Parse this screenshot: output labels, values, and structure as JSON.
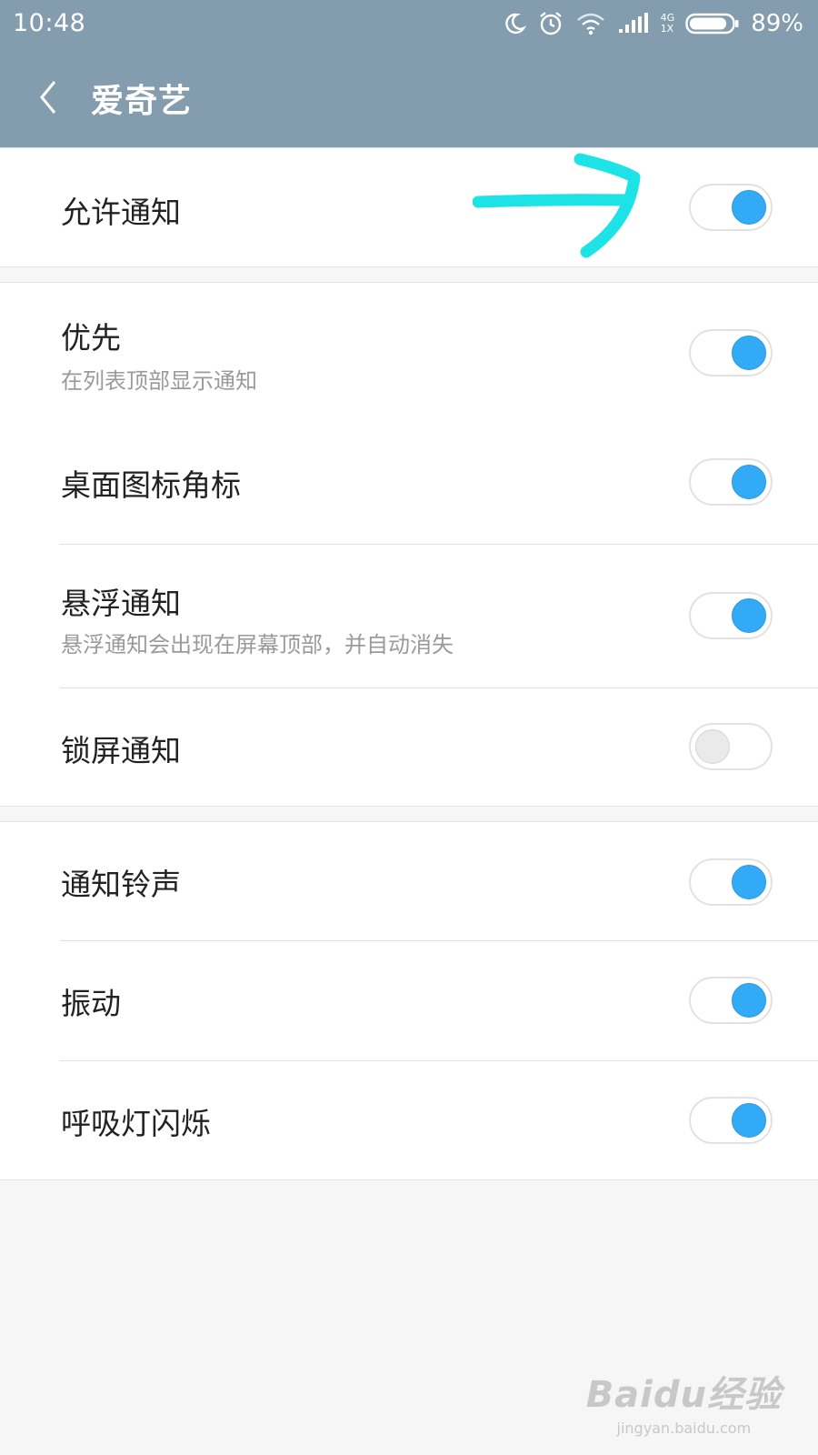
{
  "status_bar": {
    "time": "10:48",
    "icons": [
      "moon-icon",
      "alarm-icon",
      "wifi-icon",
      "signal-icon",
      "battery-icon"
    ],
    "network_top": "4G",
    "network_bottom": "1X",
    "battery_pct": "89%",
    "battery_level": 0.89
  },
  "app_bar": {
    "back_icon": "chevron-left-icon",
    "title": "爱奇艺"
  },
  "settings": {
    "allow_notifications": {
      "label": "允许通知",
      "on": true
    },
    "priority": {
      "label": "优先",
      "desc": "在列表顶部显示通知",
      "on": true
    },
    "badge": {
      "label": "桌面图标角标",
      "on": true
    },
    "floating": {
      "label": "悬浮通知",
      "desc": "悬浮通知会出现在屏幕顶部，并自动消失",
      "on": true
    },
    "lockscreen": {
      "label": "锁屏通知",
      "on": false
    },
    "ringtone": {
      "label": "通知铃声",
      "on": true
    },
    "vibrate": {
      "label": "振动",
      "on": true
    },
    "breathing_light": {
      "label": "呼吸灯闪烁",
      "on": true
    }
  },
  "colors": {
    "header": "#839cae",
    "toggle_on": "#33aaf6",
    "annotation": "#1ee3e6"
  },
  "watermark": {
    "main": "Baidu经验",
    "sub": "jingyan.baidu.com"
  }
}
